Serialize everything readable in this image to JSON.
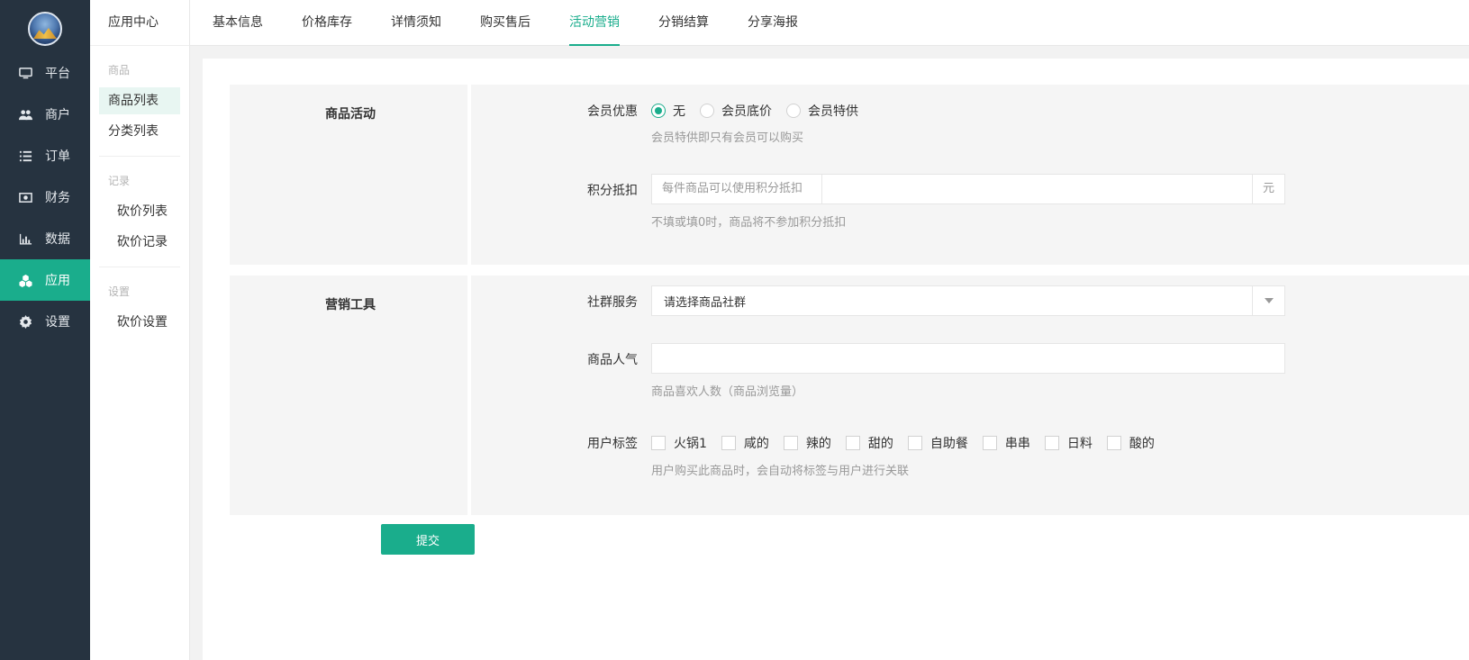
{
  "nav": {
    "items": [
      {
        "label": "平台",
        "icon": "monitor-icon"
      },
      {
        "label": "商户",
        "icon": "users-icon"
      },
      {
        "label": "订单",
        "icon": "list-icon"
      },
      {
        "label": "财务",
        "icon": "money-icon"
      },
      {
        "label": "数据",
        "icon": "bar-chart-icon"
      },
      {
        "label": "应用",
        "icon": "cubes-icon",
        "active": true
      },
      {
        "label": "设置",
        "icon": "gear-icon"
      }
    ]
  },
  "subnav": {
    "title": "应用中心",
    "groups": [
      {
        "title": "商品",
        "items": [
          "商品列表",
          "分类列表"
        ]
      },
      {
        "title": "记录",
        "items": [
          "砍价列表",
          "砍价记录"
        ]
      },
      {
        "title": "设置",
        "items": [
          "砍价设置"
        ]
      }
    ]
  },
  "tabs": [
    "基本信息",
    "价格库存",
    "详情须知",
    "购买售后",
    "活动营销",
    "分销结算",
    "分享海报"
  ],
  "active_tab": "活动营销",
  "form": {
    "section1_label": "商品活动",
    "member_discount": {
      "label": "会员优惠",
      "options": [
        "无",
        "会员底价",
        "会员特供"
      ],
      "selected": "无",
      "help": "会员特供即只有会员可以购买"
    },
    "points": {
      "label": "积分抵扣",
      "prefix": "每件商品可以使用积分抵扣",
      "value": "",
      "suffix": "元",
      "help": "不填或填0时，商品将不参加积分抵扣"
    },
    "section2_label": "营销工具",
    "community": {
      "label": "社群服务",
      "selected": "请选择商品社群"
    },
    "popularity": {
      "label": "商品人气",
      "value": "",
      "help": "商品喜欢人数（商品浏览量）"
    },
    "user_tags": {
      "label": "用户标签",
      "options": [
        "火锅1",
        "咸的",
        "辣的",
        "甜的",
        "自助餐",
        "串串",
        "日料",
        "酸的"
      ],
      "help": "用户购买此商品时，会自动将标签与用户进行关联"
    },
    "submit_label": "提交"
  }
}
